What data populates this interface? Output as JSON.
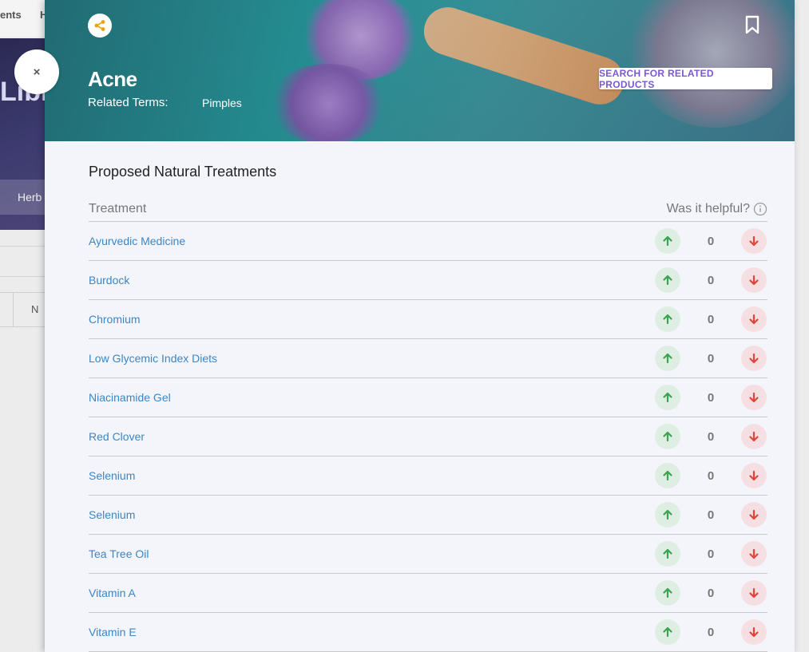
{
  "background": {
    "nav_items": [
      "ents",
      "H"
    ],
    "hero_title": "Libr",
    "hero_tab": "Herb",
    "table_col": "N"
  },
  "close_button": "×",
  "header": {
    "title": "Acne",
    "related_label": "Related Terms:",
    "related_terms": "Pimples",
    "search_button": "SEARCH FOR RELATED PRODUCTS"
  },
  "section_title": "Proposed Natural Treatments",
  "table": {
    "col_treatment": "Treatment",
    "col_helpful": "Was it helpful?",
    "rows": [
      {
        "name": "Ayurvedic Medicine",
        "count": "0"
      },
      {
        "name": "Burdock",
        "count": "0"
      },
      {
        "name": "Chromium",
        "count": "0"
      },
      {
        "name": "Low Glycemic Index Diets",
        "count": "0"
      },
      {
        "name": "Niacinamide Gel",
        "count": "0"
      },
      {
        "name": "Red Clover",
        "count": "0"
      },
      {
        "name": "Selenium",
        "count": "0"
      },
      {
        "name": "Selenium",
        "count": "0"
      },
      {
        "name": "Tea Tree Oil",
        "count": "0"
      },
      {
        "name": "Vitamin A",
        "count": "0"
      },
      {
        "name": "Vitamin E",
        "count": "0"
      }
    ]
  },
  "colors": {
    "link": "#3a86c6",
    "accent": "#7a58d0",
    "upvote": "#3aa44f",
    "downvote": "#e0453a",
    "share": "#e8a317"
  }
}
